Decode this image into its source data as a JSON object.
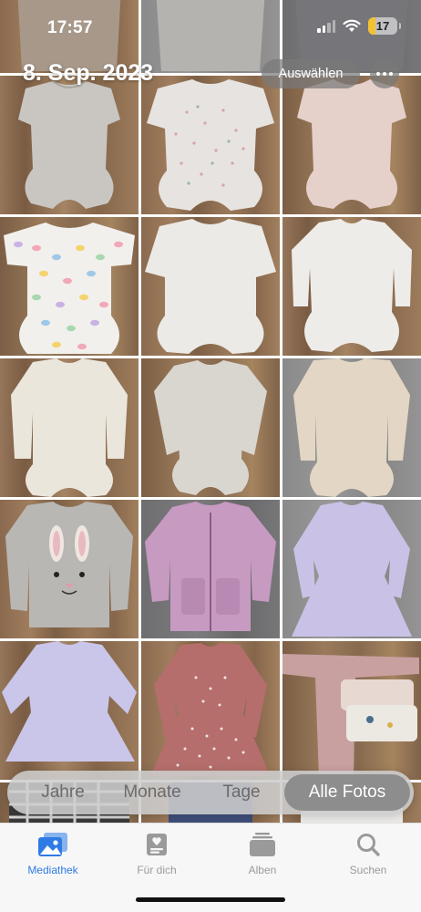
{
  "status_bar": {
    "time": "17:57",
    "battery": "17"
  },
  "header": {
    "date": "8. Sep. 2023",
    "select_label": "Auswählen",
    "more_icon": "ellipsis-icon"
  },
  "segments": {
    "items": [
      "Jahre",
      "Monate",
      "Tage",
      "Alle Fotos"
    ],
    "selected": "Alle Fotos"
  },
  "tabbar": {
    "items": [
      {
        "label": "Mediathek",
        "icon": "photo-library-icon",
        "active": true
      },
      {
        "label": "Für dich",
        "icon": "for-you-icon",
        "active": false
      },
      {
        "label": "Alben",
        "icon": "albums-icon",
        "active": false
      },
      {
        "label": "Suchen",
        "icon": "search-icon",
        "active": false
      }
    ]
  },
  "photos": [
    {
      "subject": "taupe bodysuit"
    },
    {
      "subject": "gray bodysuit"
    },
    {
      "subject": "dark bodysuit"
    },
    {
      "subject": "gray short-sleeve bodysuit"
    },
    {
      "subject": "white dotted bodysuit"
    },
    {
      "subject": "pink bodysuit"
    },
    {
      "subject": "multicolor polka-dot bodysuit"
    },
    {
      "subject": "white bodysuit"
    },
    {
      "subject": "white long-sleeve bodysuit"
    },
    {
      "subject": "cream long-sleeve bodysuit"
    },
    {
      "subject": "light gray long-sleeve bodysuit"
    },
    {
      "subject": "beige long-sleeve bodysuit"
    },
    {
      "subject": "gray bunny sweatshirt"
    },
    {
      "subject": "lilac fleece jacket"
    },
    {
      "subject": "lavender dress"
    },
    {
      "subject": "lavender long-sleeve dress"
    },
    {
      "subject": "rose ruffle dress"
    },
    {
      "subject": "pink sleepsuit set"
    },
    {
      "subject": "checked clothing"
    },
    {
      "subject": "blue clothing"
    },
    {
      "subject": "white clothing"
    }
  ],
  "colors": {
    "accent": "#2f7be5",
    "tab_inactive": "#9a9a9a"
  }
}
